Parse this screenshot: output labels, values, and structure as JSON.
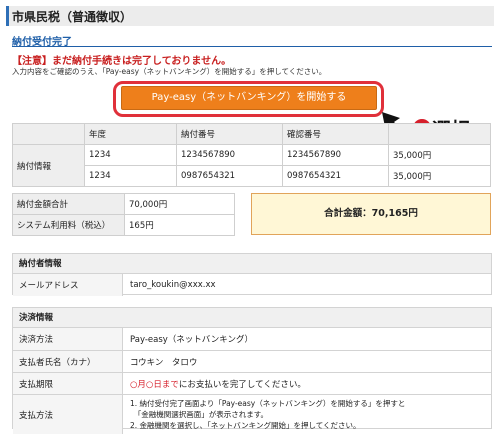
{
  "header": {
    "title": "市県民税（普通徴収）"
  },
  "section": {
    "title": "納付受付完了"
  },
  "notice": "【注意】まだ納付手続きは完了しておりません。",
  "instruction": "入力内容をご確認のうえ、「Pay-easy（ネットバンキング）を開始する」を押してください。",
  "pay_button": {
    "label": "Pay-easy（ネットバンキング）を開始する"
  },
  "annotation": {
    "badge": "❶",
    "label": "選択"
  },
  "payment_table": {
    "headers": [
      "年度",
      "納付番号",
      "確認番号"
    ],
    "row_label": "納付情報",
    "rows": [
      {
        "year": "1234",
        "pay_no": "1234567890",
        "confirm_no": "1234567890",
        "amount": "35,000円"
      },
      {
        "year": "1234",
        "pay_no": "0987654321",
        "confirm_no": "0987654321",
        "amount": "35,000円"
      }
    ]
  },
  "summary": {
    "total_label": "納付金額合計",
    "total_value": "70,000円",
    "fee_label": "システム利用料（税込）",
    "fee_value": "165円",
    "grand_total": "合計金額：70,165円"
  },
  "payer_info": {
    "title": "納付者情報",
    "email_label": "メールアドレス",
    "email_value": "taro_koukin@xxx.xx"
  },
  "settlement": {
    "title": "決済情報",
    "method_label": "決済方法",
    "method_value": "Pay-easy（ネットバンキング）",
    "name_label": "支払者氏名（カナ）",
    "name_value": "コウキン　タロウ",
    "deadline_label": "支払期限",
    "deadline_highlight": "○月○日まで",
    "deadline_rest": "にお支払いを完了してください。",
    "howto_label": "支払方法",
    "howto_steps": [
      "1. 納付受付完了画面より「Pay-easy（ネットバンキング）を開始する」を押すと",
      "　「金融機関選択画面」が表示されます。",
      "2. 金融機関を選択し、「ネットバンキング開始」を押してください。"
    ]
  },
  "colors": {
    "accent": "#1f5fa8",
    "button": "#ee7f1b",
    "highlight": "#e0303a",
    "total_bg": "#fff7d6"
  }
}
